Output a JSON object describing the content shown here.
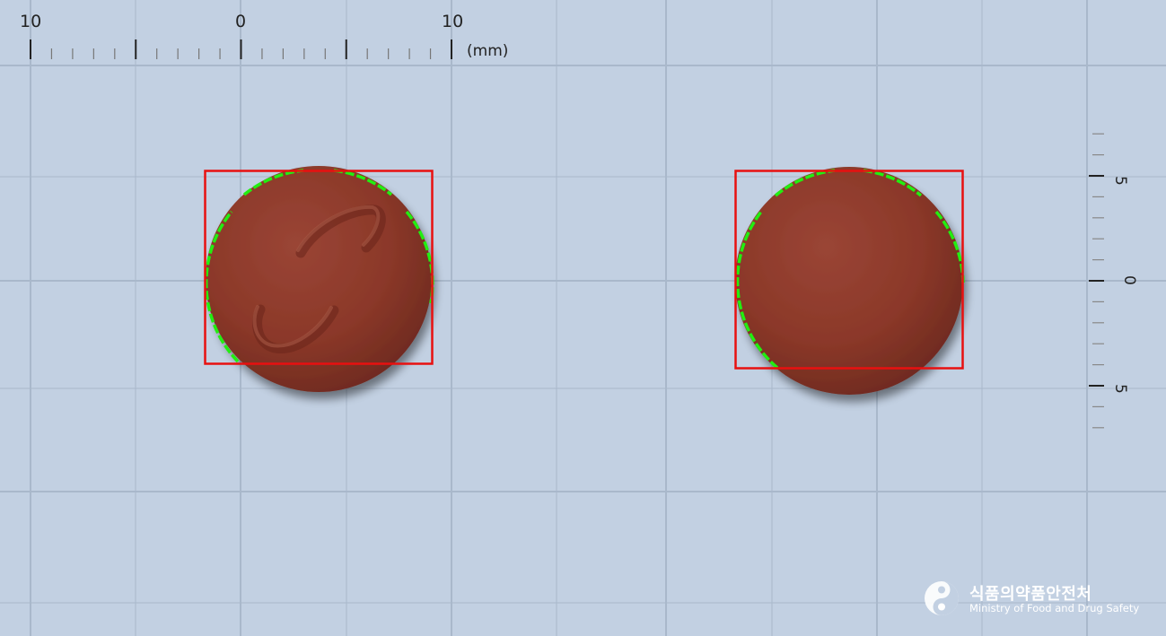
{
  "top_ruler": {
    "labels": [
      "10",
      "0",
      "10"
    ],
    "unit": "(mm)"
  },
  "side_ruler": {
    "labels": [
      "5",
      "0",
      "5"
    ]
  },
  "pills": [
    {
      "name": "pill-front",
      "color": "#8e3a2c",
      "marking": "imprinted-logo"
    },
    {
      "name": "pill-back",
      "color": "#8e3a2c",
      "marking": "none"
    }
  ],
  "overlay_colors": {
    "bounding_box": "#e81010",
    "contour": "#22ee11",
    "grid": "#a9b8cb",
    "background": "#c2d0e2"
  },
  "watermark": {
    "korean": "식품의약품안전처",
    "english": "Ministry of Food and Drug Safety"
  }
}
